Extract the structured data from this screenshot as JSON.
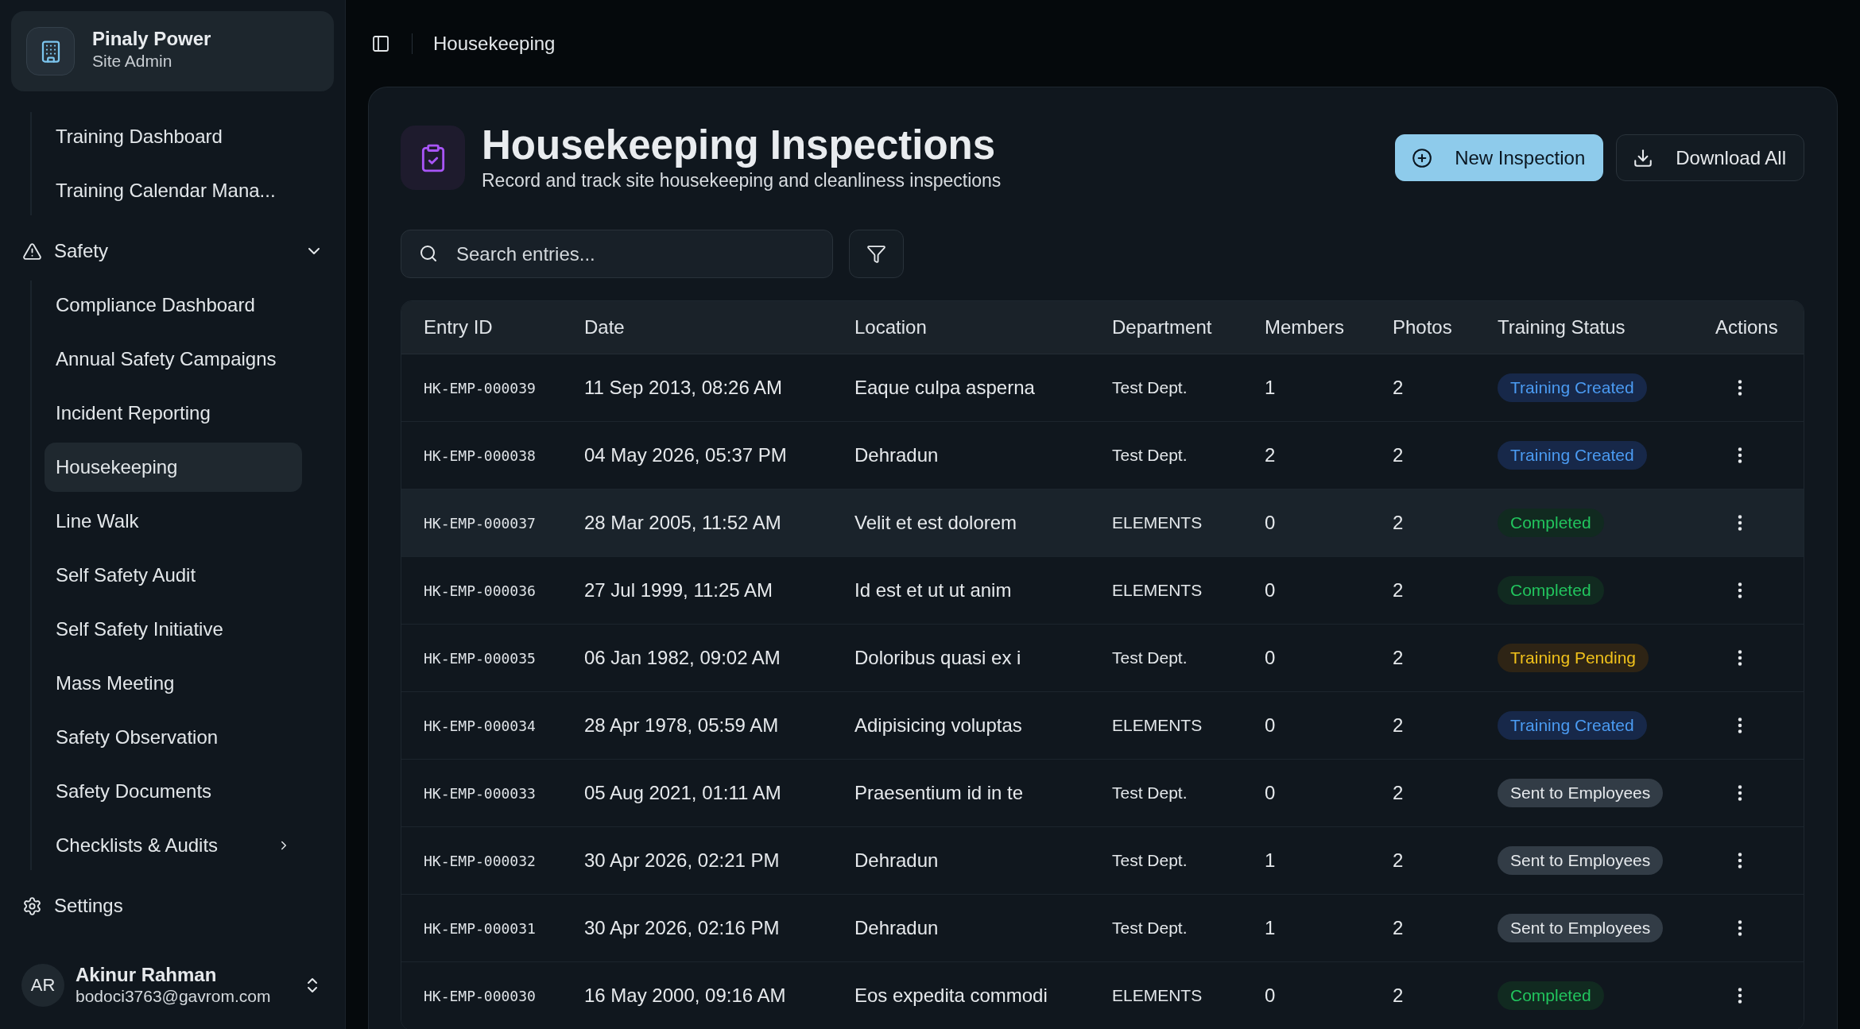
{
  "sidebar": {
    "org": {
      "name": "Pinaly Power",
      "role": "Site Admin"
    },
    "nav": [
      {
        "kind": "group",
        "children": [
          {
            "kind": "link",
            "label": "Training Dashboard",
            "selected": false
          },
          {
            "kind": "link",
            "label": "Training Calendar Mana...",
            "selected": false
          }
        ]
      },
      {
        "kind": "group",
        "label": "Safety",
        "expanded": true,
        "children": [
          {
            "kind": "link",
            "label": "Compliance Dashboard",
            "selected": false
          },
          {
            "kind": "link",
            "label": "Annual Safety Campaigns",
            "selected": false
          },
          {
            "kind": "link",
            "label": "Incident Reporting",
            "selected": false
          },
          {
            "kind": "link",
            "label": "Housekeeping",
            "selected": true
          },
          {
            "kind": "link",
            "label": "Line Walk",
            "selected": false
          },
          {
            "kind": "link",
            "label": "Self Safety Audit",
            "selected": false
          },
          {
            "kind": "link",
            "label": "Self Safety Initiative",
            "selected": false
          },
          {
            "kind": "link",
            "label": "Mass Meeting",
            "selected": false
          },
          {
            "kind": "link",
            "label": "Safety Observation",
            "selected": false
          },
          {
            "kind": "link",
            "label": "Safety Documents",
            "selected": false
          },
          {
            "kind": "submenu",
            "label": "Checklists & Audits",
            "selected": false,
            "expanded": false
          }
        ]
      },
      {
        "kind": "link",
        "label": "Settings",
        "selected": false
      }
    ],
    "user": {
      "initials": "AR",
      "name": "Akinur Rahman",
      "email": "bodoci3763@gavrom.com"
    }
  },
  "topbar": {
    "breadcrumb": "Housekeeping"
  },
  "page": {
    "title": "Housekeeping Inspections",
    "subtitle": "Record and track site housekeeping and cleanliness inspections",
    "actions": [
      {
        "kind": "primary",
        "label": "New Inspection"
      },
      {
        "kind": "secondary",
        "label": "Download All"
      }
    ],
    "search": {
      "placeholder": "Search entries..."
    }
  },
  "table": {
    "columns": [
      "Entry ID",
      "Date",
      "Location",
      "Department",
      "Members",
      "Photos",
      "Training Status",
      "Actions"
    ],
    "rows": [
      {
        "entry_id": "HK-EMP-000039",
        "date": "11 Sep 2013, 08:26 AM",
        "location": "Eaque culpa asperna",
        "department": "Test Dept.",
        "members": "1",
        "photos": "2",
        "status": {
          "label": "Training Created",
          "kind": "created"
        },
        "hovered": false
      },
      {
        "entry_id": "HK-EMP-000038",
        "date": "04 May 2026, 05:37 PM",
        "location": "Dehradun",
        "department": "Test Dept.",
        "members": "2",
        "photos": "2",
        "status": {
          "label": "Training Created",
          "kind": "created"
        },
        "hovered": false
      },
      {
        "entry_id": "HK-EMP-000037",
        "date": "28 Mar 2005, 11:52 AM",
        "location": "Velit et est dolorem",
        "department": "ELEMENTS",
        "members": "0",
        "photos": "2",
        "status": {
          "label": "Completed",
          "kind": "completed"
        },
        "hovered": true
      },
      {
        "entry_id": "HK-EMP-000036",
        "date": "27 Jul 1999, 11:25 AM",
        "location": "Id est et ut ut anim",
        "department": "ELEMENTS",
        "members": "0",
        "photos": "2",
        "status": {
          "label": "Completed",
          "kind": "completed"
        },
        "hovered": false
      },
      {
        "entry_id": "HK-EMP-000035",
        "date": "06 Jan 1982, 09:02 AM",
        "location": "Doloribus quasi ex i",
        "department": "Test Dept.",
        "members": "0",
        "photos": "2",
        "status": {
          "label": "Training Pending",
          "kind": "pending"
        },
        "hovered": false
      },
      {
        "entry_id": "HK-EMP-000034",
        "date": "28 Apr 1978, 05:59 AM",
        "location": "Adipisicing voluptas",
        "department": "ELEMENTS",
        "members": "0",
        "photos": "2",
        "status": {
          "label": "Training Created",
          "kind": "created"
        },
        "hovered": false
      },
      {
        "entry_id": "HK-EMP-000033",
        "date": "05 Aug 2021, 01:11 AM",
        "location": "Praesentium id in te",
        "department": "Test Dept.",
        "members": "0",
        "photos": "2",
        "status": {
          "label": "Sent to Employees",
          "kind": "sent"
        },
        "hovered": false
      },
      {
        "entry_id": "HK-EMP-000032",
        "date": "30 Apr 2026, 02:21 PM",
        "location": "Dehradun",
        "department": "Test Dept.",
        "members": "1",
        "photos": "2",
        "status": {
          "label": "Sent to Employees",
          "kind": "sent"
        },
        "hovered": false
      },
      {
        "entry_id": "HK-EMP-000031",
        "date": "30 Apr 2026, 02:16 PM",
        "location": "Dehradun",
        "department": "Test Dept.",
        "members": "1",
        "photos": "2",
        "status": {
          "label": "Sent to Employees",
          "kind": "sent"
        },
        "hovered": false
      },
      {
        "entry_id": "HK-EMP-000030",
        "date": "16 May 2000, 09:16 AM",
        "location": "Eos expedita commodi",
        "department": "ELEMENTS",
        "members": "0",
        "photos": "2",
        "status": {
          "label": "Completed",
          "kind": "completed"
        },
        "hovered": false
      }
    ]
  }
}
